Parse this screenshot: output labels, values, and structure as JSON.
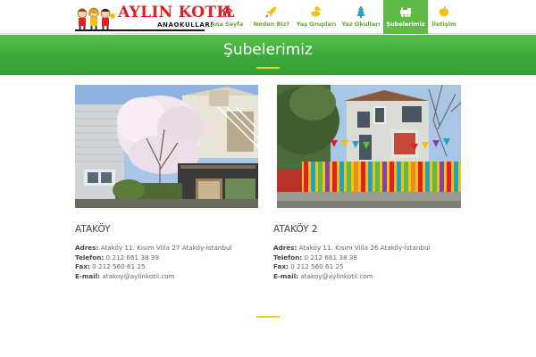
{
  "brand": {
    "title": "AYLIN KOTIL",
    "subtitle": "ANAOKULLARI",
    "title_color": "#e31e24"
  },
  "nav": {
    "items": [
      {
        "label": "Ana Sayfa",
        "icon": "home-icon"
      },
      {
        "label": "Neden Biz?",
        "icon": "rocket-icon"
      },
      {
        "label": "Yaş Grupları",
        "icon": "duck-icon"
      },
      {
        "label": "Yaz Okulları",
        "icon": "tree-icon"
      },
      {
        "label": "Şubelerimiz",
        "icon": "train-icon",
        "active": true
      },
      {
        "label": "İletişim",
        "icon": "apple-icon"
      }
    ],
    "accent": "#5dbb46",
    "label_color": "#6ca53a"
  },
  "banner": {
    "title": "Şubelerimiz"
  },
  "branches": [
    {
      "name": "ATAKÖY",
      "address_label": "Adres:",
      "address": "Ataköy 11. Kısım Villa 27 Ataköy-İstanbul",
      "phone_label": "Telefon:",
      "phone": "0 212 661 38 39",
      "fax_label": "Fax:",
      "fax": "0 212 560 61 25",
      "email_label": "E-mail:",
      "email": "atakoy@aylinkotil.com"
    },
    {
      "name": "ATAKÖY 2",
      "address_label": "Adres:",
      "address": "Ataköy 11. Kısım Villa 26 Ataköy-İstanbul",
      "phone_label": "Telefon:",
      "phone": "0 212 661 38 38",
      "fax_label": "Fax:",
      "fax": "0 212 560 61 25",
      "email_label": "E-mail:",
      "email": "atakoy@aylinkotil.com"
    }
  ]
}
